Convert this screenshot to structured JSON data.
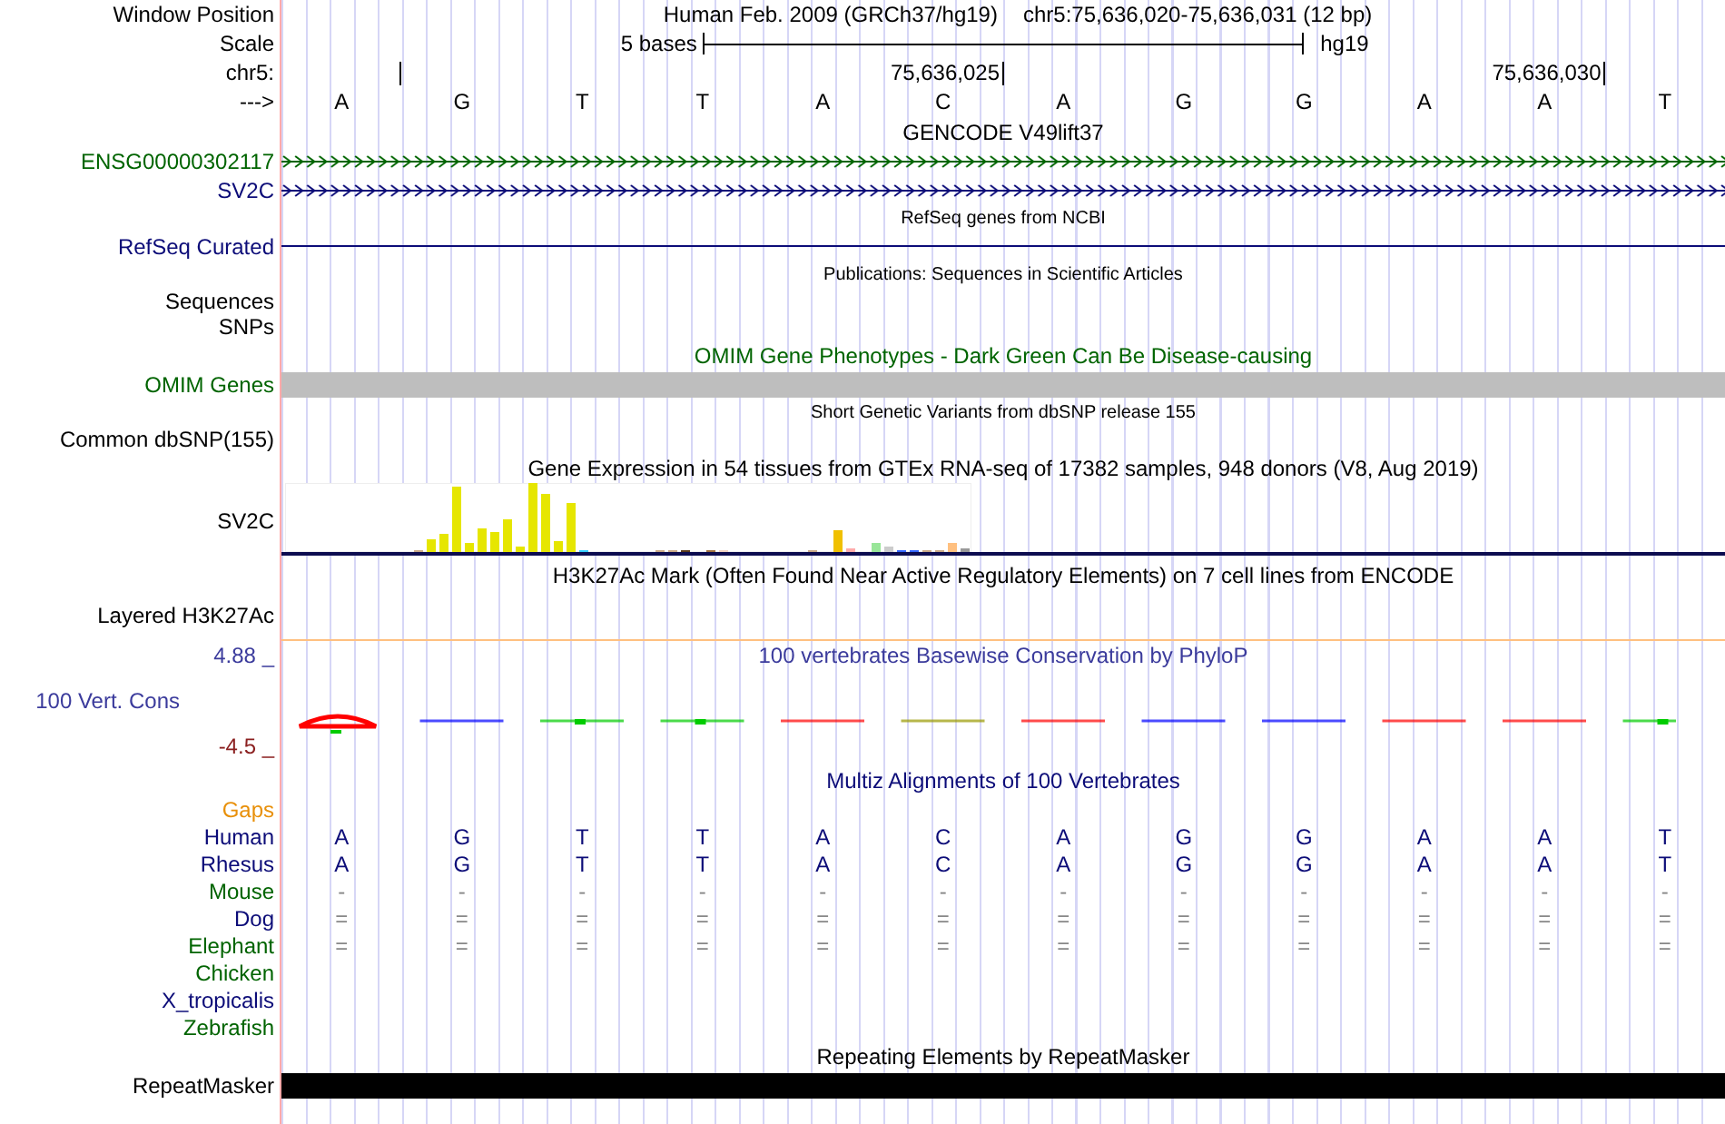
{
  "window_position": {
    "label": "Window Position",
    "assembly": "Human Feb. 2009 (GRCh37/hg19)",
    "position": "chr5:75,636,020-75,636,031 (12 bp)"
  },
  "scale": {
    "label": "Scale",
    "span": "5 bases",
    "assembly": "hg19"
  },
  "ruler": {
    "label": "chr5:",
    "labels": [
      "75,636,025",
      "75,636,030"
    ]
  },
  "bases": {
    "label": "--->",
    "letters": [
      "A",
      "G",
      "T",
      "T",
      "A",
      "C",
      "A",
      "G",
      "G",
      "A",
      "A",
      "T"
    ]
  },
  "tracks": [
    {
      "kind": "gene",
      "title": "GENCODE V49lift37",
      "rows": [
        {
          "label": "ENSG00000302117",
          "color": "#006400"
        },
        {
          "label": "SV2C",
          "color": "#0c0c78"
        }
      ]
    },
    {
      "kind": "line",
      "title": "RefSeq genes from NCBI",
      "rows": [
        {
          "label": "RefSeq Curated",
          "color": "#0c0c78"
        }
      ]
    },
    {
      "kind": "compact",
      "title": "Publications: Sequences in Scientific Articles",
      "rows": [
        {
          "label": "Sequences",
          "color": "#000000"
        },
        {
          "label": "SNPs",
          "color": "#000000"
        }
      ]
    },
    {
      "kind": "bar",
      "title": "OMIM Gene Phenotypes - Dark Green Can Be Disease-causing",
      "rows": [
        {
          "label": "OMIM Genes",
          "color": "#006400"
        }
      ]
    },
    {
      "kind": "compact",
      "title": "Short Genetic Variants from dbSNP release 155",
      "rows": [
        {
          "label": "Common dbSNP(155)",
          "color": "#000000"
        }
      ]
    },
    {
      "kind": "expression",
      "title": "Gene Expression in 54 tissues from GTEx RNA-seq of 17382 samples, 948 donors (V8, Aug 2019)",
      "rows": [
        {
          "label": "SV2C",
          "color": "#000000"
        }
      ]
    },
    {
      "kind": "empty",
      "title": "H3K27Ac Mark (Often Found Near Active Regulatory Elements) on 7 cell lines from ENCODE",
      "rows": [
        {
          "label": "Layered H3K27Ac",
          "color": "#000000"
        }
      ]
    },
    {
      "kind": "conservation",
      "title": "100 vertebrates Basewise Conservation by PhyloP",
      "max": "4.88 _",
      "min": "-4.5 _",
      "rows": [
        {
          "label": "100 Vert. Cons",
          "color": "#3b3b9c"
        }
      ]
    },
    {
      "kind": "alignment",
      "title": "Multiz Alignments of 100 Vertebrates",
      "rows": [
        {
          "label": "Gaps",
          "color": "#e8900a"
        },
        {
          "label": "Human",
          "color": "#0c0c78",
          "bases": [
            "A",
            "G",
            "T",
            "T",
            "A",
            "C",
            "A",
            "G",
            "G",
            "A",
            "A",
            "T"
          ]
        },
        {
          "label": "Rhesus",
          "color": "#0c0c78",
          "bases": [
            "A",
            "G",
            "T",
            "T",
            "A",
            "C",
            "A",
            "G",
            "G",
            "A",
            "A",
            "T"
          ]
        },
        {
          "label": "Mouse",
          "color": "#006400",
          "bases": [
            "-",
            "-",
            "-",
            "-",
            "-",
            "-",
            "-",
            "-",
            "-",
            "-",
            "-",
            "-"
          ]
        },
        {
          "label": "Dog",
          "color": "#0c0c78",
          "bases": [
            "=",
            "=",
            "=",
            "=",
            "=",
            "=",
            "=",
            "=",
            "=",
            "=",
            "=",
            "="
          ]
        },
        {
          "label": "Elephant",
          "color": "#006400",
          "bases": [
            "=",
            "=",
            "=",
            "=",
            "=",
            "=",
            "=",
            "=",
            "=",
            "=",
            "=",
            "="
          ]
        },
        {
          "label": "Chicken",
          "color": "#006400"
        },
        {
          "label": "X_tropicalis",
          "color": "#0c0c78"
        },
        {
          "label": "Zebrafish",
          "color": "#006400"
        }
      ]
    },
    {
      "kind": "repeat",
      "title": "Repeating Elements by RepeatMasker",
      "rows": [
        {
          "label": "RepeatMasker",
          "color": "#000000"
        }
      ]
    }
  ]
}
